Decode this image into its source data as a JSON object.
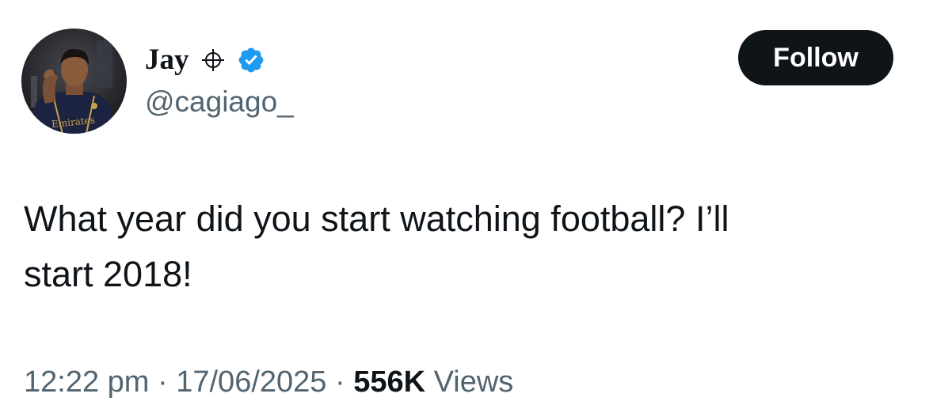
{
  "author": {
    "display_name": "Jay",
    "handle": "@cagiago_",
    "avatar_shirt_text": "Emirates"
  },
  "follow_button": {
    "label": "Follow"
  },
  "tweet": {
    "text_line1": "What year did you start watching football? I’ll",
    "text_line2": "start 2018!"
  },
  "meta": {
    "time": "12:22 pm",
    "separator": "·",
    "date": "17/06/2025",
    "views_count": "556K",
    "views_label": "Views"
  },
  "icons": {
    "crosshair": "crosshair-icon",
    "verified": "verified-badge-icon"
  },
  "colors": {
    "text_primary": "#0f1419",
    "text_secondary": "#536471",
    "verified_blue": "#1d9bf0",
    "follow_button_bg": "#0f1419",
    "follow_button_text": "#ffffff"
  }
}
